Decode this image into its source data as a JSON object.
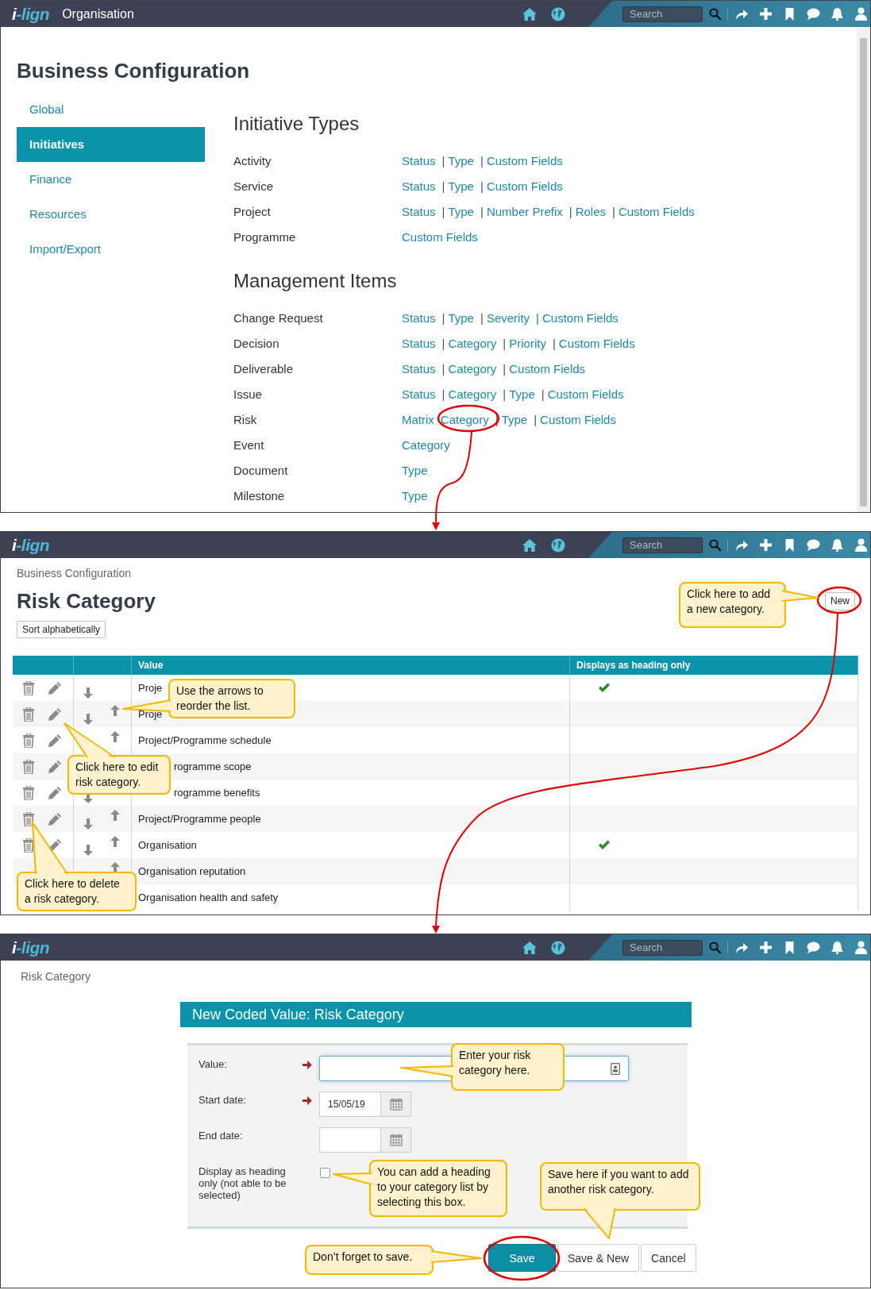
{
  "configuration_screen": {
    "top_bar": {
      "logo": "i-lign",
      "title": "Organisation",
      "search": {
        "placeholder": "Search"
      }
    },
    "title": "Business Configuration",
    "sidebar": [
      {
        "label": "Global",
        "selected": false
      },
      {
        "label": "Initiatives",
        "selected": true
      },
      {
        "label": "Finance",
        "selected": false
      },
      {
        "label": "Resources",
        "selected": false
      },
      {
        "label": "Import/Export",
        "selected": false
      }
    ],
    "sections": [
      {
        "title": "Initiative Types",
        "rows": [
          {
            "label": "Activity",
            "links": [
              {
                "label": "Status"
              },
              {
                "separator": "|",
                "label": "Type"
              },
              {
                "separator": "|",
                "label": "Custom Fields"
              }
            ]
          },
          {
            "label": "Service",
            "links": [
              {
                "label": "Status"
              },
              {
                "separator": "|",
                "label": "Type"
              },
              {
                "separator": "|",
                "label": "Custom Fields"
              }
            ]
          },
          {
            "label": "Project",
            "links": [
              {
                "label": "Status"
              },
              {
                "separator": "|",
                "label": "Type"
              },
              {
                "separator": "|",
                "label": "Number Prefix"
              },
              {
                "separator": "|",
                "label": "Roles"
              },
              {
                "separator": "|",
                "label": "Custom Fields"
              }
            ]
          },
          {
            "label": "Programme",
            "links": [
              {
                "label": "Custom Fields"
              }
            ]
          }
        ]
      },
      {
        "title": "Management Items",
        "rows": [
          {
            "label": "Change Request",
            "links": [
              {
                "label": "Status"
              },
              {
                "separator": "|",
                "label": "Type"
              },
              {
                "separator": "|",
                "label": "Severity"
              },
              {
                "separator": "|",
                "label": "Custom Fields"
              }
            ]
          },
          {
            "label": "Decision",
            "links": [
              {
                "label": "Status"
              },
              {
                "separator": "|",
                "label": "Category"
              },
              {
                "separator": "|",
                "label": "Priority"
              },
              {
                "separator": "|",
                "label": "Custom Fields"
              }
            ]
          },
          {
            "label": "Deliverable",
            "links": [
              {
                "label": "Status"
              },
              {
                "separator": "|",
                "label": "Category"
              },
              {
                "separator": "|",
                "label": "Custom Fields"
              }
            ]
          },
          {
            "label": "Issue",
            "links": [
              {
                "label": "Status"
              },
              {
                "separator": "|",
                "label": "Category"
              },
              {
                "separator": "|",
                "label": "Type"
              },
              {
                "separator": "|",
                "label": "Custom Fields"
              }
            ]
          },
          {
            "label": "Risk",
            "links": [
              {
                "label": "Matrix"
              },
              {
                "label": "Category"
              },
              {
                "separator": "|",
                "label": "Type"
              },
              {
                "separator": "|",
                "label": "Custom Fields"
              }
            ]
          },
          {
            "label": "Event",
            "links": [
              {
                "label": "Category"
              }
            ]
          },
          {
            "label": "Document",
            "links": [
              {
                "label": "Type"
              }
            ]
          },
          {
            "label": "Milestone",
            "links": [
              {
                "label": "Type"
              }
            ]
          }
        ]
      }
    ]
  },
  "risk_category_screen": {
    "top_bar": {
      "logo": "i-lign",
      "search": {
        "placeholder": "Search"
      }
    },
    "breadcrumb": "Business Configuration",
    "title": "Risk Category",
    "sort_button": "Sort alphabetically",
    "new_button": "New",
    "table": {
      "columns": [
        {
          "label": "Value"
        },
        {
          "label": "Displays as heading only"
        }
      ],
      "rows": [
        {
          "delete_icon": true,
          "edit_icon": true,
          "down_icon": true,
          "up_icon": false,
          "value": "Proje",
          "heading_only": true
        },
        {
          "delete_icon": true,
          "edit_icon": true,
          "down_icon": true,
          "up_icon": true,
          "value": "Proje",
          "heading_only": false
        },
        {
          "delete_icon": true,
          "edit_icon": true,
          "down_icon": false,
          "up_icon": true,
          "value": "Project/Programme schedule",
          "heading_only": false
        },
        {
          "delete_icon": true,
          "edit_icon": true,
          "down_icon": false,
          "up_icon": false,
          "value": "rogramme scope",
          "hidden_start": true,
          "heading_only": false
        },
        {
          "delete_icon": true,
          "edit_icon": true,
          "down_icon": true,
          "up_icon": false,
          "value": "rogramme benefits",
          "hidden_start": true,
          "heading_only": false
        },
        {
          "delete_icon": true,
          "edit_icon": true,
          "down_icon": true,
          "up_icon": true,
          "value": "Project/Programme people",
          "heading_only": false
        },
        {
          "delete_icon": true,
          "edit_icon": true,
          "down_icon": true,
          "up_icon": true,
          "value": "Organisation",
          "heading_only": true
        },
        {
          "delete_icon": false,
          "edit_icon": false,
          "down_icon": false,
          "up_icon": true,
          "value": "Organisation reputation",
          "heading_only": false
        },
        {
          "delete_icon": false,
          "edit_icon": false,
          "down_icon": false,
          "up_icon": false,
          "value": "Organisation health and safety",
          "heading_only": false
        }
      ]
    },
    "callouts": [
      {
        "text": "Click here to add a new category."
      },
      {
        "text": "Use the arrows to reorder the list."
      },
      {
        "text": "Click here to edit risk category."
      },
      {
        "text": "Click here to delete a risk category."
      }
    ]
  },
  "new_value_screen": {
    "top_bar": {
      "logo": "i-lign",
      "search": {
        "placeholder": "Search"
      }
    },
    "breadcrumb": "Risk Category",
    "dialog_title": "New Coded Value: Risk Category",
    "fields": [
      {
        "kind": "text",
        "label": "Value:",
        "required": true,
        "focused": true
      },
      {
        "kind": "date",
        "label": "Start date:",
        "required": true,
        "value": "15/05/19"
      },
      {
        "kind": "date",
        "label": "End date:",
        "required": false
      },
      {
        "kind": "checkbox",
        "label": "Display as heading only (not able to be selected)",
        "checked": false
      }
    ],
    "buttons": [
      {
        "label": "Save",
        "kind": "primary"
      },
      {
        "label": "Save & New",
        "kind": "default"
      },
      {
        "label": "Cancel",
        "kind": "default"
      }
    ],
    "callouts": [
      {
        "text": "Enter your risk category here."
      },
      {
        "text": "You can add a heading to your category list by selecting this box."
      },
      {
        "text": "Save here if you want to add another risk category."
      },
      {
        "text": "Don’t forget to save."
      }
    ]
  }
}
